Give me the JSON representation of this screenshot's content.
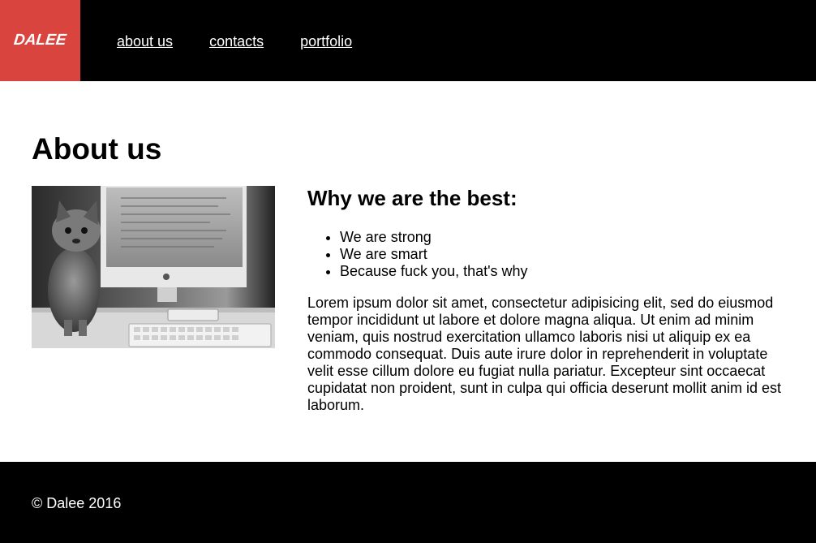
{
  "header": {
    "logo_text": "DALEE",
    "nav": [
      {
        "label": "about us"
      },
      {
        "label": "contacts"
      },
      {
        "label": "portfolio"
      }
    ]
  },
  "main": {
    "title": "About us",
    "image_alt": "kitten",
    "subtitle": "Why we are the best:",
    "list": [
      "We are strong",
      "We are smart",
      "Because fuck you, that's why"
    ],
    "paragraph": "Lorem ipsum dolor sit amet, consectetur adipisicing elit, sed do eiusmod tempor incididunt ut labore et dolore magna aliqua. Ut enim ad minim veniam, quis nostrud exercitation ullamco laboris nisi ut aliquip ex ea commodo consequat. Duis aute irure dolor in reprehenderit in voluptate velit esse cillum dolore eu fugiat nulla pariatur. Excepteur sint occaecat cupidatat non proident, sunt in culpa qui officia deserunt mollit anim id est laborum."
  },
  "footer": {
    "copyright": "© Dalee 2016"
  },
  "colors": {
    "header_bg": "#000000",
    "logo_bg": "#d9453e",
    "footer_bg": "#000000"
  }
}
